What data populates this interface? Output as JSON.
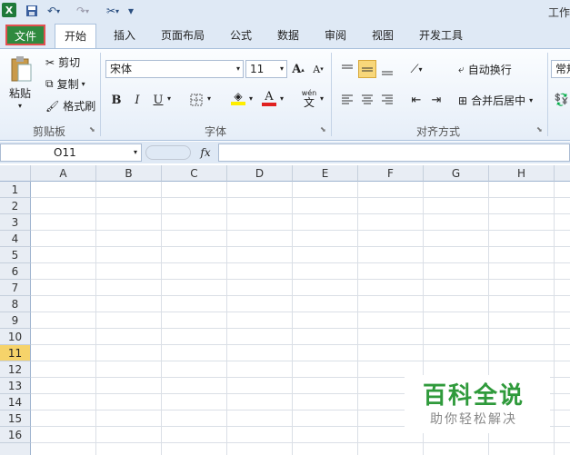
{
  "title_partial": "工作",
  "qat": {
    "customize_glyph": "▾"
  },
  "tabs": [
    {
      "label": "文件"
    },
    {
      "label": "开始"
    },
    {
      "label": "插入"
    },
    {
      "label": "页面布局"
    },
    {
      "label": "公式"
    },
    {
      "label": "数据"
    },
    {
      "label": "审阅"
    },
    {
      "label": "视图"
    },
    {
      "label": "开发工具"
    }
  ],
  "clipboard": {
    "paste": "粘贴",
    "cut": "剪切",
    "copy": "复制",
    "format_painter": "格式刷",
    "group": "剪贴板"
  },
  "font": {
    "name": "宋体",
    "size": "11",
    "bold": "B",
    "italic": "I",
    "underline": "U",
    "group": "字体",
    "wen": "wén",
    "wen_char": "文"
  },
  "alignment": {
    "wrap": "自动换行",
    "merge": "合并后居中",
    "group": "对齐方式"
  },
  "number": {
    "format_partial": "常规"
  },
  "formula_bar": {
    "name_box": "O11",
    "fx": "fx",
    "formula": ""
  },
  "columns": [
    "A",
    "B",
    "C",
    "D",
    "E",
    "F",
    "G",
    "H"
  ],
  "rows": [
    "1",
    "2",
    "3",
    "4",
    "5",
    "6",
    "7",
    "8",
    "9",
    "10",
    "11",
    "12",
    "13",
    "14",
    "15",
    "16"
  ],
  "selected_row": "11",
  "watermark": {
    "title": "百科全说",
    "subtitle": "助你轻松解决"
  },
  "colors": {
    "file_tab": "#2f8a3f",
    "highlight_border": "#e25050",
    "accent_blue": "#2b4f80",
    "selected_header": "#f6d36a"
  }
}
